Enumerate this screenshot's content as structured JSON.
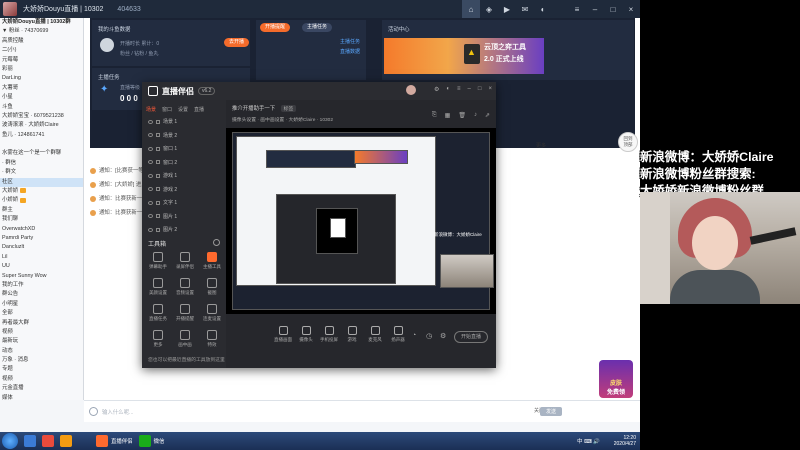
{
  "window": {
    "title": "大娇娇Douyu直播 | 10302",
    "count": "404633"
  },
  "contacts": [
    {
      "label": "大娇娇Douyu直播 | 10302群",
      "group": true
    },
    {
      "label": "▼ 粉丝 · 74370699"
    },
    {
      "label": "高质控酸"
    },
    {
      "label": "二(小)"
    },
    {
      "label": "元莓莓"
    },
    {
      "label": "彩丽"
    },
    {
      "label": "DarLing"
    },
    {
      "label": "大薯哥"
    },
    {
      "label": "小星"
    },
    {
      "label": "斗鱼"
    },
    {
      "label": "大娇娇宝宝 · 6079521238"
    },
    {
      "label": "波涛滚滚 · 大娇娇Claire"
    },
    {
      "label": "鱼儿 · 124861741"
    },
    {
      "label": ""
    },
    {
      "label": "水雾在这一个是一个群聊"
    },
    {
      "label": "· 群信"
    },
    {
      "label": "· 群文"
    },
    {
      "label": "社区",
      "sel": true
    },
    {
      "label": "大娇娇",
      "badge": true
    },
    {
      "label": "小娇娇",
      "badge": true
    },
    {
      "label": "群主"
    },
    {
      "label": "我们聊"
    },
    {
      "label": "OverwatchXD"
    },
    {
      "label": "Pamrdi Party"
    },
    {
      "label": "Dancluzlt"
    },
    {
      "label": "Lil"
    },
    {
      "label": "UU"
    },
    {
      "label": "Super Sunny Wow"
    },
    {
      "label": "我的工作"
    },
    {
      "label": "群公告"
    },
    {
      "label": "小明星"
    },
    {
      "label": "全部"
    },
    {
      "label": "再者最大群"
    },
    {
      "label": "视频"
    },
    {
      "label": "最新玩"
    },
    {
      "label": "动态"
    },
    {
      "label": "万象 · 消息"
    },
    {
      "label": "专题"
    },
    {
      "label": "视频"
    },
    {
      "label": "元金直播"
    },
    {
      "label": "媒体"
    }
  ],
  "messages": [
    {
      "text": "通知：[比赛获一等奖] 小伙伴"
    },
    {
      "text": "通知：[大娇娇] 进入 [上线]"
    },
    {
      "text": "通知：比赛获新一轮大娇娇"
    },
    {
      "text": "通知：比赛获新一轮大娇娇"
    }
  ],
  "dashboard": {
    "left_title": "我的斗鱼数据",
    "stats_row1": "开播时长 累计：0",
    "stats_row2": "粉丝 / 钻粉 / 鱼丸",
    "level_label": "直播等级",
    "level_value": "0 0 0",
    "section2_title": "主播任务",
    "pill_orange": "去开播",
    "middle_tab1": "开播提醒",
    "middle_tab2": "主播任务",
    "link1": "主播任务",
    "link2": "直播数据",
    "right_title": "活动中心",
    "banner_line1": "云顶之弈工具",
    "banner_line2": "2.0 正式上线",
    "more": "更多"
  },
  "input": {
    "placeholder": "输入什么呢...",
    "send": "发送",
    "close": "关闭"
  },
  "app": {
    "name": "直播伴侣",
    "version": "v6.2",
    "tabs": [
      "场景",
      "窗口",
      "设置",
      "直播"
    ],
    "scenes": [
      "场景 1",
      "场景 2",
      "窗口 1",
      "窗口 2",
      "游戏 1",
      "游戏 2",
      "文字 1",
      "图片 1",
      "图片 2"
    ],
    "tools_title": "工具箱",
    "tools": [
      "弹幕助手",
      "录屏伴侣",
      "主播工具",
      "美颜设置",
      "音频设置",
      "截图",
      "直播任务",
      "开播提醒",
      "连麦设置",
      "更多",
      "画中画",
      "特效"
    ],
    "footer": "您也可以把最近直播的工具放到这里",
    "main_title": "推介开播助手一下",
    "main_tag": "标签",
    "main_tools": "摄像头设置 · 画中画设置 · 大娇娇Claire · 10302",
    "bottom": [
      "直播画面",
      "摄像头",
      "手机投屏",
      "游戏",
      "麦克风",
      "扬声器"
    ],
    "start": "开始直播"
  },
  "float": {
    "line1": "回到",
    "line2": "顶部"
  },
  "stream": {
    "weibo_line1": "新浪微博：大娇娇Claire",
    "weibo_line2": "新浪微博粉丝群搜索:",
    "weibo_line3": "大娇娇新浪微博粉丝群"
  },
  "promo": {
    "line1": "皮肤",
    "line2": "免费领"
  },
  "taskbar": {
    "item1": "直播伴侣",
    "item2": "微信",
    "tray": "中 ⌨ 🔊",
    "time": "12:20",
    "date": "2020/4/27"
  }
}
